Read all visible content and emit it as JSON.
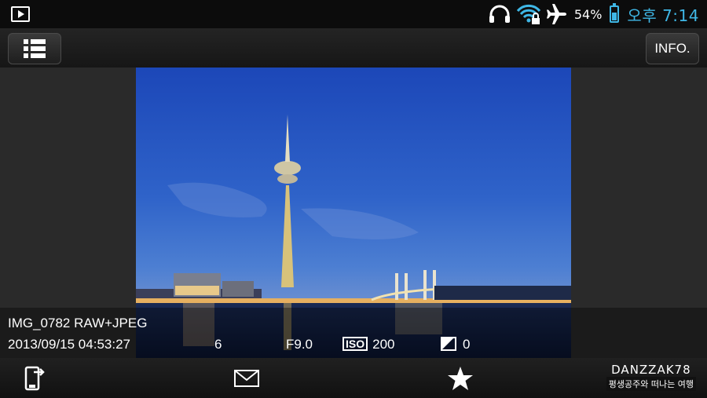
{
  "status_bar": {
    "battery_percent": "54%",
    "battery_level": 0.54,
    "time": "오후 7:14",
    "icons": [
      "play-icon",
      "headphones-icon",
      "wifi-lock-icon",
      "airplane-icon",
      "battery-icon"
    ],
    "accent_color": "#3fb7e6"
  },
  "toolbar": {
    "list_icon": "list-icon",
    "info_label": "INFO."
  },
  "photo": {
    "subject": "night-city-tower-photo"
  },
  "info": {
    "file_name": "IMG_0782 RAW+JPEG",
    "datetime": "2013/09/15 04:53:27",
    "shutter": "6",
    "aperture": "F9.0",
    "iso_label": "ISO",
    "iso_value": "200",
    "exposure_comp": "0"
  },
  "bottom_bar": {
    "icons": [
      "phone-transfer-icon",
      "mail-icon",
      "star-icon"
    ],
    "watermark_title": "DANZZAK78",
    "watermark_sub": "평생공주와 떠나는 여행"
  }
}
